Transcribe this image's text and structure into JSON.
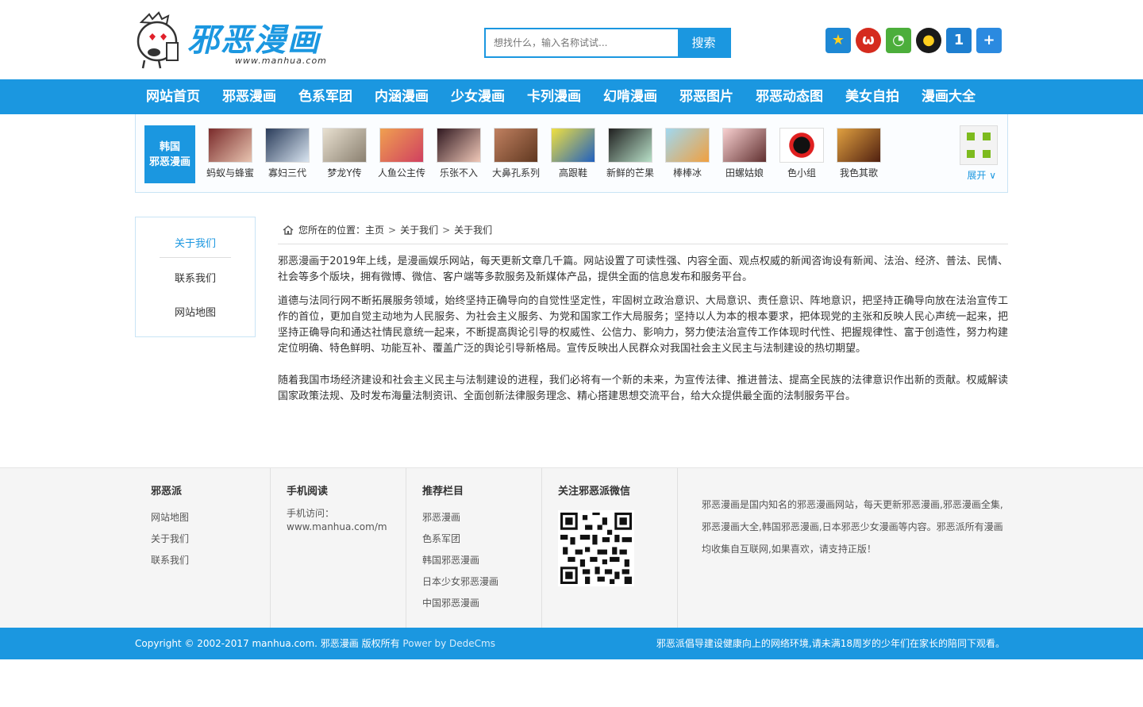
{
  "header": {
    "logo_title": "邪恶漫画",
    "logo_url": "www.manhua.com",
    "search_placeholder": "想找什么，输入名称试试...",
    "search_button": "搜索"
  },
  "social_icons": [
    "qzone-star-icon",
    "weibo-icon",
    "wechat-icon",
    "qq-icon",
    "one-icon",
    "plus-icon"
  ],
  "nav": [
    "网站首页",
    "邪恶漫画",
    "色系军团",
    "内涵漫画",
    "少女漫画",
    "卡列漫画",
    "幻啃漫画",
    "邪恶图片",
    "邪恶动态图",
    "美女自拍",
    "漫画大全"
  ],
  "strip": {
    "tag_line1": "韩国",
    "tag_line2": "邪恶漫画",
    "items": [
      "蚂蚁与蜂蜜",
      "寡妇三代",
      "梦龙Y传",
      "人鱼公主传",
      "乐张不入",
      "大鼻孔系列",
      "高跟鞋",
      "新鲜的芒果",
      "棒棒冰",
      "田螺姑娘",
      "色小组",
      "我色其歌"
    ],
    "expand_label": "展开"
  },
  "sidebar": [
    "关于我们",
    "联系我们",
    "网站地图"
  ],
  "breadcrumb": {
    "prefix": "您所在的位置：",
    "items": [
      "主页",
      "关于我们",
      "关于我们"
    ]
  },
  "content": {
    "p1": "邪恶漫画于2019年上线，是漫画娱乐网站，每天更新文章几千篇。网站设置了可读性强、内容全面、观点权威的新闻咨询设有新闻、法治、经济、普法、民情、社会等多个版块，拥有微博、微信、客户端等多款服务及新媒体产品，提供全面的信息发布和服务平台。",
    "p2": "道德与法同行网不断拓展服务领域，始终坚持正确导向的自觉性坚定性，牢固树立政治意识、大局意识、责任意识、阵地意识，把坚持正确导向放在法治宣传工作的首位，更加自觉主动地为人民服务、为社会主义服务、为党和国家工作大局服务；坚持以人为本的根本要求，把体现党的主张和反映人民心声统一起来，把坚持正确导向和通达社情民意统一起来，不断提高舆论引导的权威性、公信力、影响力，努力使法治宣传工作体现时代性、把握规律性、富于创造性，努力构建定位明确、特色鲜明、功能互补、覆盖广泛的舆论引导新格局。宣传反映出人民群众对我国社会主义民主与法制建设的热切期望。",
    "p3": "随着我国市场经济建设和社会主义民主与法制建设的进程，我们必将有一个新的未来，为宣传法律、推进普法、提高全民族的法律意识作出新的贡献。权威解读国家政策法规、及时发布海量法制资讯、全面创新法律服务理念、精心搭建思想交流平台，给大众提供最全面的法制服务平台。"
  },
  "footer": {
    "col1_title": "邪恶派",
    "col1_links": [
      "网站地图",
      "关于我们",
      "联系我们"
    ],
    "col2_title": "手机阅读",
    "col2_line1": "手机访问：",
    "col2_line2": "www.manhua.com/m",
    "col3_title": "推荐栏目",
    "col3_links": [
      "邪恶漫画",
      "色系军团",
      "韩国邪恶漫画",
      "日本少女邪恶漫画",
      "中国邪恶漫画"
    ],
    "col4_title": "关注邪恶派微信",
    "about": "邪恶漫画是国内知名的邪恶漫画网站，每天更新邪恶漫画,邪恶漫画全集,邪恶漫画大全,韩国邪恶漫画,日本邪恶少女漫画等内容。邪恶派所有漫画均收集自互联网,如果喜欢，请支持正版！"
  },
  "bottom": {
    "copyright": "Copyright © 2002-2017 manhua.com. 邪恶漫画 版权所有",
    "powered": "Power by DedeCms",
    "notice": "邪恶派倡导建设健康向上的网络环境,请未满18周岁的少年们在家长的陪同下观看。"
  },
  "colors": {
    "brand_blue": "#1b97e0"
  }
}
